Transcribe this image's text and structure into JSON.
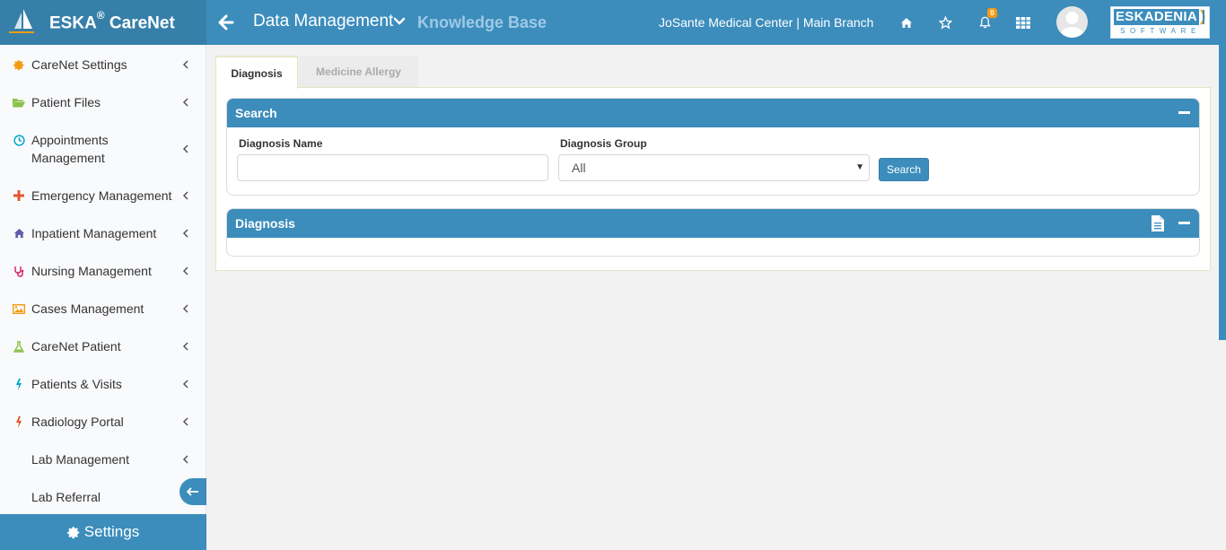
{
  "header": {
    "brand": "ESKA",
    "brand_reg": "®",
    "brand_suffix": " CareNet",
    "title": "Data Management",
    "subtitle": "Knowledge Base",
    "organization": "JoSante Medical Center | Main Branch",
    "notification_count": "0",
    "company_logo_top": "ESKADENIA",
    "company_logo_bottom": "SOFTWARE"
  },
  "sidebar": {
    "items": [
      {
        "label": "CareNet Settings",
        "icon": "gear-icon",
        "color": "#f39c12"
      },
      {
        "label": "Patient Files",
        "icon": "folder-open-icon",
        "color": "#8bc34a"
      },
      {
        "label": "Appointments Management",
        "icon": "clock-icon",
        "color": "#00a7d0"
      },
      {
        "label": "Emergency Management",
        "icon": "plus-icon",
        "color": "#e4572e"
      },
      {
        "label": "Inpatient Management",
        "icon": "home-icon",
        "color": "#605ca8"
      },
      {
        "label": "Nursing Management",
        "icon": "stethoscope-icon",
        "color": "#d81b60"
      },
      {
        "label": "Cases Management",
        "icon": "image-icon",
        "color": "#f39c12"
      },
      {
        "label": "CareNet Patient",
        "icon": "flask-icon",
        "color": "#8bc34a"
      },
      {
        "label": "Patients & Visits",
        "icon": "bolt-icon",
        "color": "#00a7d0"
      },
      {
        "label": "Radiology Portal",
        "icon": "bolt-icon",
        "color": "#e4572e"
      },
      {
        "label": "Lab Management",
        "icon": "",
        "color": ""
      },
      {
        "label": "Lab Referral",
        "icon": "",
        "color": ""
      }
    ],
    "settings_label": "Settings"
  },
  "tabs": [
    {
      "label": "Diagnosis",
      "active": true
    },
    {
      "label": "Medicine Allergy",
      "active": false
    }
  ],
  "search_box": {
    "title": "Search",
    "diagnosis_name_label": "Diagnosis Name",
    "diagnosis_name_value": "",
    "diagnosis_group_label": "Diagnosis Group",
    "diagnosis_group_value": "All",
    "search_button": "Search"
  },
  "results_box": {
    "title": "Diagnosis"
  },
  "colors": {
    "primary": "#3c8dbc",
    "primary_dark": "#367fa9",
    "accent": "#f39c12"
  }
}
